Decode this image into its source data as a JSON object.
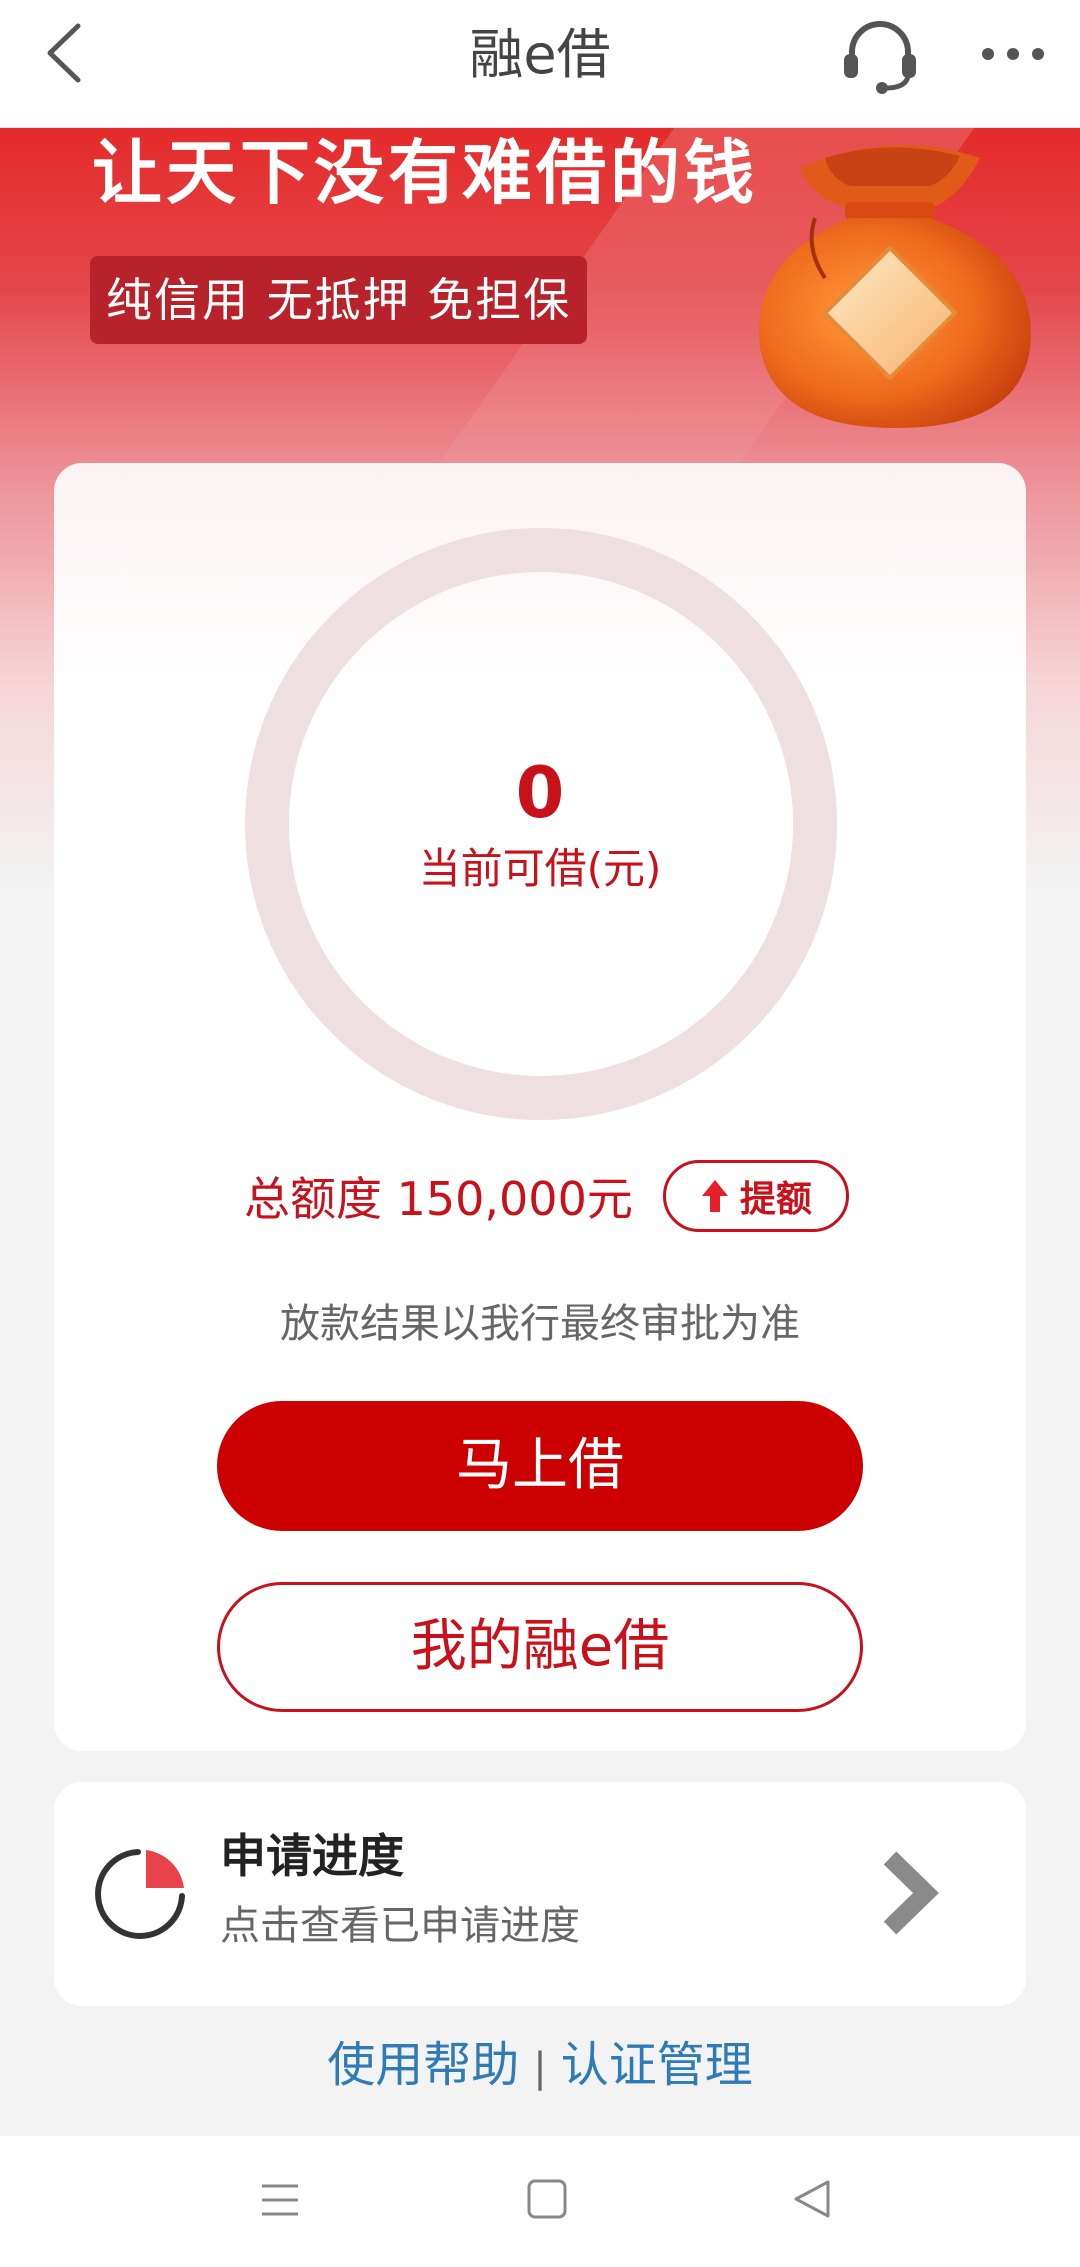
{
  "nav": {
    "title": "融e借",
    "icons": [
      "back-chevron-icon",
      "headset-icon",
      "more-icon"
    ]
  },
  "hero": {
    "title": "让天下没有难借的钱",
    "tagline": "纯信用 无抵押 免担保",
    "illustration": "money-bag"
  },
  "loan_card": {
    "available_amount": "0",
    "available_label": "当前可借(元)",
    "total_limit": "总额度 150,000元",
    "raise_limit_label": "提额",
    "notice": "放款结果以我行最终审批为准",
    "borrow_now_label": "马上借",
    "my_loan_label": "我的融e借"
  },
  "progress": {
    "title": "申请进度",
    "subtitle": "点击查看已申请进度"
  },
  "links": {
    "help": "使用帮助",
    "separator": "|",
    "auth": "认证管理"
  },
  "colors": {
    "brand_red": "#cc0000",
    "text_red": "#c8111a",
    "link_blue": "#2f7bb5"
  },
  "system_nav": [
    "menu-icon",
    "home-icon",
    "back-icon"
  ]
}
